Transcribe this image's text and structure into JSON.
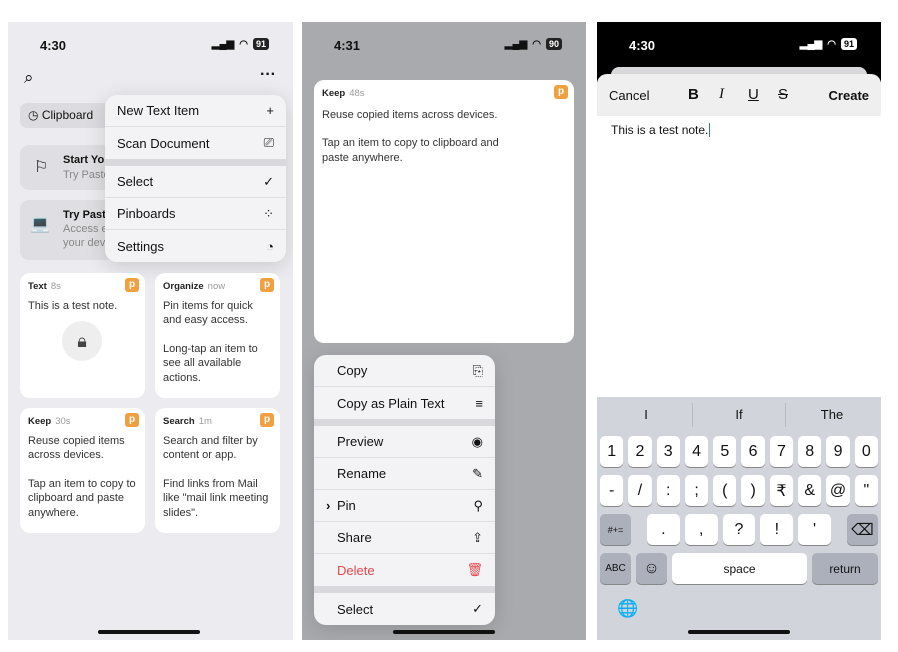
{
  "panel1": {
    "status": {
      "time": "4:30",
      "battery": "91"
    },
    "clipboard_chip": "Clipboard",
    "banners": [
      {
        "title": "Start Yo",
        "subtitle": "Try Paste"
      },
      {
        "title": "Try Paste",
        "line1": "Access e",
        "line2": "your dev"
      }
    ],
    "menu": [
      {
        "label": "New Text Item",
        "icon": "plus-icon",
        "glyph": "+"
      },
      {
        "label": "Scan Document",
        "icon": "scan-icon",
        "glyph": "⎚"
      },
      {
        "label": "Select",
        "icon": "checkmark-circle-icon",
        "glyph": "✓"
      },
      {
        "label": "Pinboards",
        "icon": "grid-icon",
        "glyph": "⁘"
      },
      {
        "label": "Settings",
        "icon": "settings-icon",
        "glyph": "◔"
      }
    ],
    "cards": [
      {
        "title": "Text",
        "time": "8s",
        "body": "This is a test note."
      },
      {
        "title": "Organize",
        "time": "now",
        "body": "Pin items for quick and easy access.",
        "body2": "Long-tap an item to see all available actions."
      },
      {
        "title": "Keep",
        "time": "30s",
        "body": "Reuse copied items across devices.",
        "body2": "Tap an item to copy to clipboard and paste anywhere."
      },
      {
        "title": "Search",
        "time": "1m",
        "body": "Search and filter by content or app.",
        "body2": "Find links from Mail like \"mail link meeting slides\"."
      }
    ],
    "app_badge": "p"
  },
  "panel2": {
    "status": {
      "time": "4:31",
      "battery": "90"
    },
    "card": {
      "title": "Keep",
      "time": "48s",
      "body": "Reuse copied items across devices.",
      "body2": "Tap an item to copy to clipboard and paste anywhere."
    },
    "menu": [
      {
        "label": "Copy",
        "glyph": "⎘"
      },
      {
        "label": "Copy as Plain Text",
        "glyph": "≡"
      },
      {
        "label": "Preview",
        "glyph": "◉"
      },
      {
        "label": "Rename",
        "glyph": "✎"
      },
      {
        "label": "Pin",
        "glyph": "⚲",
        "submenu": "›"
      },
      {
        "label": "Share",
        "glyph": "⇪"
      },
      {
        "label": "Delete",
        "glyph": "🗑"
      },
      {
        "label": "Select",
        "glyph": "✓"
      }
    ],
    "colors": {
      "delete": "#e5484d"
    }
  },
  "panel3": {
    "status": {
      "time": "4:30",
      "battery": "91"
    },
    "toolbar": {
      "cancel": "Cancel",
      "bold": "B",
      "italic": "I",
      "underline": "U",
      "strike": "S",
      "create": "Create"
    },
    "text": "This is a test note.",
    "suggestions": [
      "I",
      "If",
      "The"
    ],
    "rows": [
      [
        "1",
        "2",
        "3",
        "4",
        "5",
        "6",
        "7",
        "8",
        "9",
        "0"
      ],
      [
        "-",
        "/",
        ":",
        ";",
        "(",
        ")",
        "₹",
        "&",
        "@",
        "\""
      ],
      [
        ".",
        ",",
        "?",
        "!",
        "'"
      ]
    ],
    "keys": {
      "symbols": "#+=",
      "delete": "⌫",
      "abc": "ABC",
      "emoji": "☺",
      "space": "space",
      "return": "return",
      "globe": "🌐"
    }
  }
}
